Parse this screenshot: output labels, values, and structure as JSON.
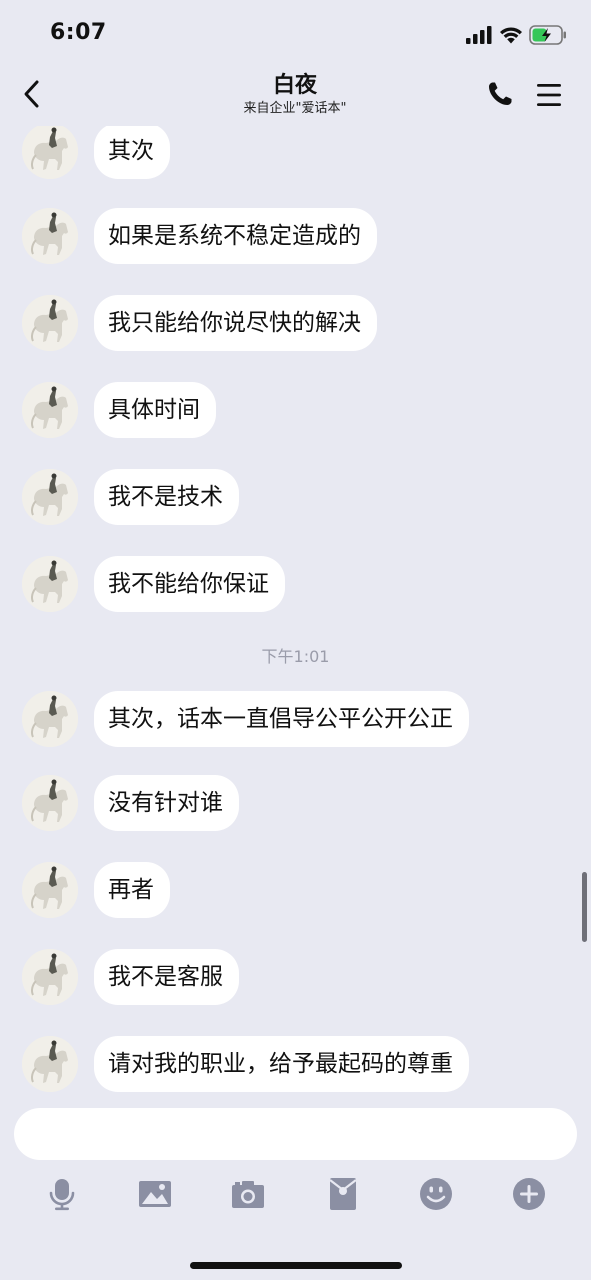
{
  "status_bar": {
    "time": "6:07"
  },
  "header": {
    "title": "白夜",
    "subtitle": "来自企业\"爱话本\""
  },
  "messages": [
    {
      "text": "其次"
    },
    {
      "text": "如果是系统不稳定造成的"
    },
    {
      "text": "我只能给你说尽快的解决"
    },
    {
      "text": "具体时间"
    },
    {
      "text": "我不是技术"
    },
    {
      "text": "我不能给你保证"
    },
    {
      "text": "其次，话本一直倡导公平公开公正"
    },
    {
      "text": "没有针对谁"
    },
    {
      "text": "再者"
    },
    {
      "text": "我不是客服"
    },
    {
      "text": "请对我的职业，给予最起码的尊重"
    }
  ],
  "timestamp": "下午1:01",
  "input": {
    "placeholder": ""
  },
  "toolbar": {
    "icons": [
      "microphone-icon",
      "image-icon",
      "camera-icon",
      "red-packet-icon",
      "emoji-icon",
      "plus-icon"
    ]
  },
  "colors": {
    "background": "#e8e9f2",
    "bubble": "#ffffff",
    "icon": "#8b8fa3",
    "timestamp": "#9a9caa"
  }
}
